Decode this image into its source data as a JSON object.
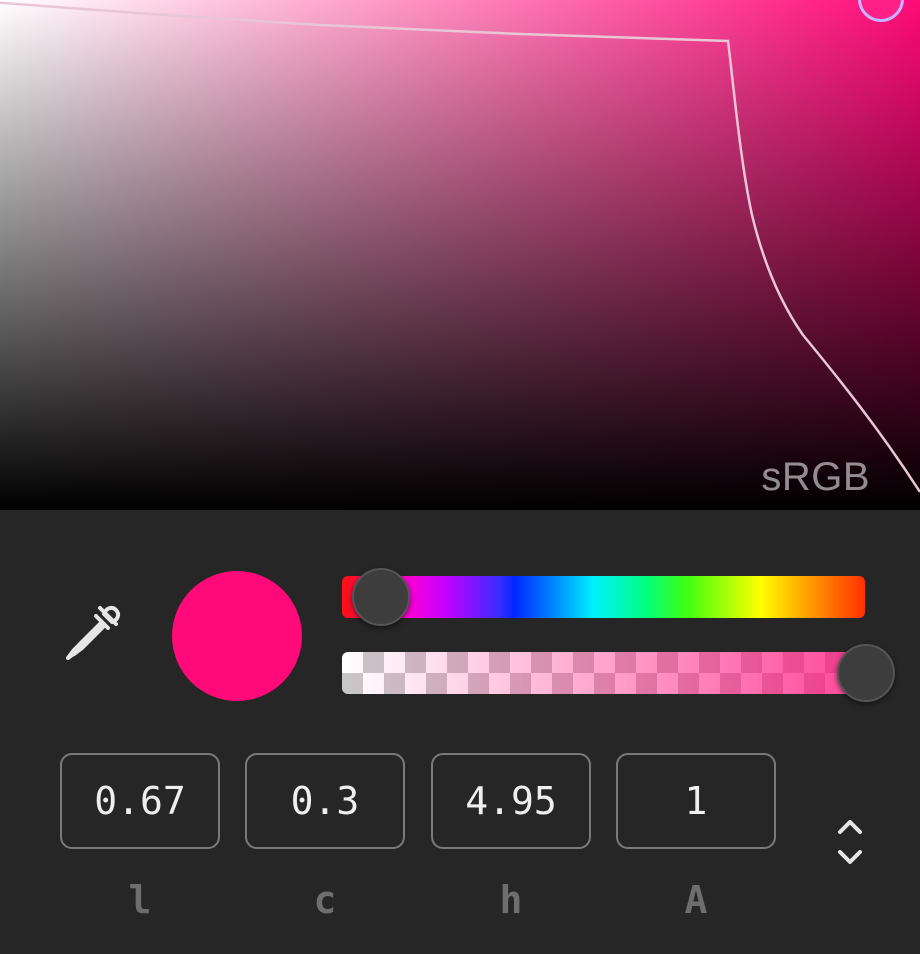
{
  "colors": {
    "current": "#ff0a78",
    "gamut_outline": "#e9c6d6",
    "area_handle_ring": "#c7b4ff"
  },
  "area": {
    "gamut_label": "sRGB"
  },
  "sliders": {
    "hue_value": 4.95,
    "alpha_value": 1
  },
  "fields": [
    {
      "name": "l",
      "value": "0.67",
      "label": "l"
    },
    {
      "name": "c",
      "value": "0.3",
      "label": "c"
    },
    {
      "name": "h",
      "value": "4.95",
      "label": "h"
    },
    {
      "name": "A",
      "value": "1",
      "label": "A"
    }
  ],
  "icons": {
    "eyedropper": "eyedropper-icon",
    "mode_switch": "chevron-up-down-icon"
  }
}
